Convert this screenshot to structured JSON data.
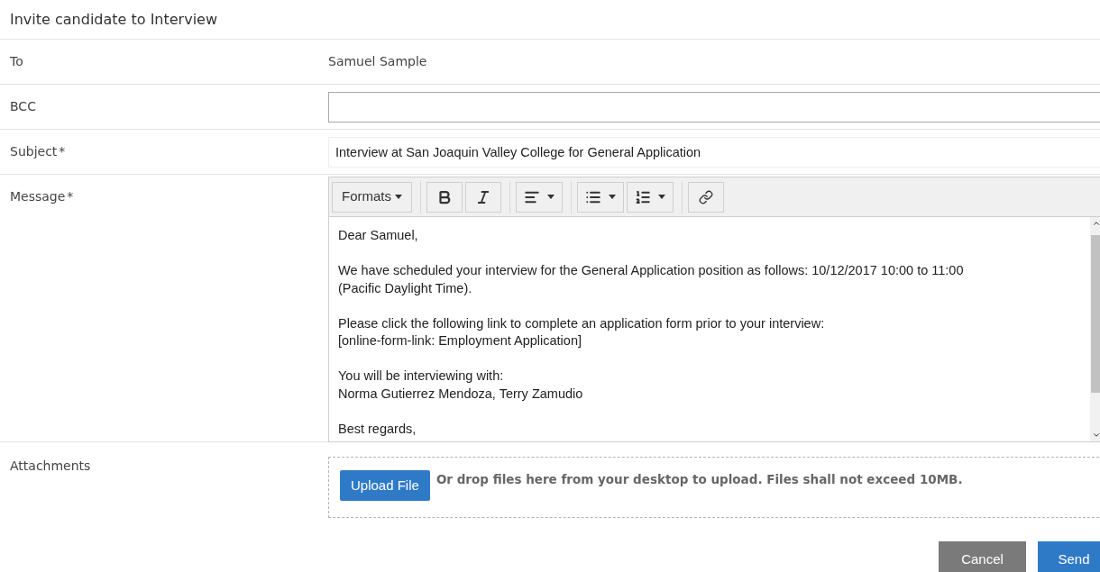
{
  "title": "Invite candidate to Interview",
  "fields": [
    {
      "kind": "text",
      "label": "To",
      "value": "Samuel Sample"
    },
    {
      "kind": "input",
      "label": "BCC"
    },
    {
      "kind": "input",
      "label": "Subject",
      "marker": "*",
      "value": "Interview at San Joaquin Valley College for General Application"
    },
    {
      "kind": "editor",
      "label": "Message",
      "marker": "*"
    },
    {
      "kind": "upload",
      "label": "Attachments"
    }
  ],
  "toolbar": [
    [
      {
        "kind": "formats",
        "label": "Formats"
      }
    ],
    [
      {
        "kind": "bold"
      },
      {
        "kind": "italic"
      }
    ],
    [
      {
        "kind": "align"
      }
    ],
    [
      {
        "kind": "bullets"
      },
      {
        "kind": "numbers"
      }
    ],
    [
      {
        "kind": "link"
      }
    ]
  ],
  "message": [
    [
      "Dear Samuel,"
    ],
    [
      "We have scheduled your interview for the General Application position as follows: 10/12/2017 10:00 to 11:00",
      "(Pacific Daylight Time)."
    ],
    [
      "Please click the following link to complete an application form prior to your interview:",
      "[online-form-link: Employment Application]"
    ],
    [
      "You will be interviewing with:",
      "Norma Gutierrez Mendoza, Terry Zamudio"
    ],
    [
      "Best regards,"
    ]
  ],
  "upload": {
    "button": "Upload File",
    "hint": "Or drop files here from your desktop to upload. Files shall not exceed 10MB."
  },
  "actions": [
    {
      "kind": "secondary",
      "label": "Cancel"
    },
    {
      "kind": "primary",
      "label": "Send"
    }
  ]
}
